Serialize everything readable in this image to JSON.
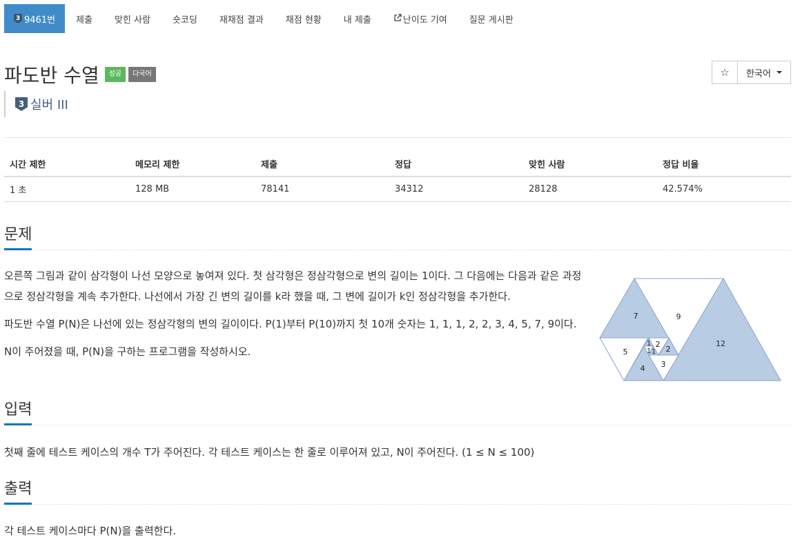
{
  "nav": {
    "problem_tier": "3",
    "problem_id": "9461번",
    "items": [
      "제출",
      "맞힌 사람",
      "숏코딩",
      "재채점 결과",
      "채점 현황",
      "내 제출",
      "난이도 기여",
      "질문 게시판"
    ]
  },
  "problem": {
    "title": "파도반 수열",
    "labels": {
      "success": "성공",
      "multilang": "다국어"
    },
    "tier_number": "3",
    "tier_text": "실버 III"
  },
  "buttons": {
    "star": "☆",
    "language": "한국어"
  },
  "info_table": {
    "headers": [
      "시간 제한",
      "메모리 제한",
      "제출",
      "정답",
      "맞힌 사람",
      "정답 비율"
    ],
    "values": [
      "1 초",
      "128 MB",
      "78141",
      "34312",
      "28128",
      "42.574%"
    ]
  },
  "sections": {
    "problem": {
      "heading": "문제",
      "paragraphs": [
        "오른쪽 그림과 같이 삼각형이 나선 모양으로 놓여져 있다. 첫 삼각형은 정삼각형으로 변의 길이는 1이다. 그 다음에는 다음과 같은 과정으로 정삼각형을 계속 추가한다. 나선에서 가장 긴 변의 길이를 k라 했을 때, 그 변에 길이가 k인 정삼각형을 추가한다.",
        "파도반 수열 P(N)은 나선에 있는 정삼각형의 변의 길이이다. P(1)부터 P(10)까지 첫 10개 숫자는 1, 1, 1, 2, 2, 3, 4, 5, 7, 9이다.",
        "N이 주어졌을 때, P(N)을 구하는 프로그램을 작성하시오."
      ]
    },
    "input": {
      "heading": "입력",
      "text": "첫째 줄에 테스트 케이스의 개수 T가 주어진다. 각 테스트 케이스는 한 줄로 이루어져 있고, N이 주어진다. (1 ≤ N ≤ 100)"
    },
    "output": {
      "heading": "출력",
      "text": "각 테스트 케이스마다 P(N)을 출력한다."
    }
  },
  "figure": {
    "labels": [
      "7",
      "9",
      "12",
      "5",
      "4",
      "3",
      "2",
      "2",
      "1",
      "1",
      "1"
    ],
    "fill_color": "#b8cce4",
    "stroke_color": "#8aa4c8"
  }
}
